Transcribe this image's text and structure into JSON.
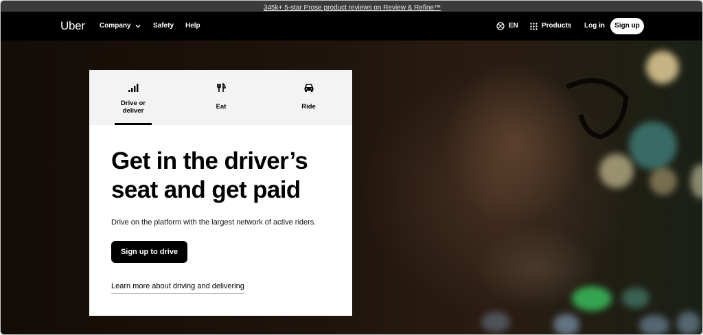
{
  "promo": {
    "text": "345k+ 5-star Prose product reviews on Review & Refine™"
  },
  "nav": {
    "logo": "Uber",
    "company": "Company",
    "safety": "Safety",
    "help": "Help",
    "language": "EN",
    "products": "Products",
    "login": "Log in",
    "signup": "Sign up"
  },
  "tabs": [
    {
      "label": "Drive or deliver",
      "icon": "signal-bars-icon",
      "selected": true
    },
    {
      "label": "Eat",
      "icon": "fork-knife-icon",
      "selected": false
    },
    {
      "label": "Ride",
      "icon": "car-icon",
      "selected": false
    }
  ],
  "hero": {
    "headline": "Get in the driver’s seat and get paid",
    "subtext": "Drive on the platform with the largest network of active riders.",
    "cta": "Sign up to drive",
    "learn_more": "Learn more about driving and delivering"
  },
  "colors": {
    "nav_bg": "#000000",
    "promo_bg": "#3b3b3b",
    "card_bg": "#ffffff",
    "tabs_bg": "#f3f3f3",
    "cta_bg": "#000000"
  }
}
